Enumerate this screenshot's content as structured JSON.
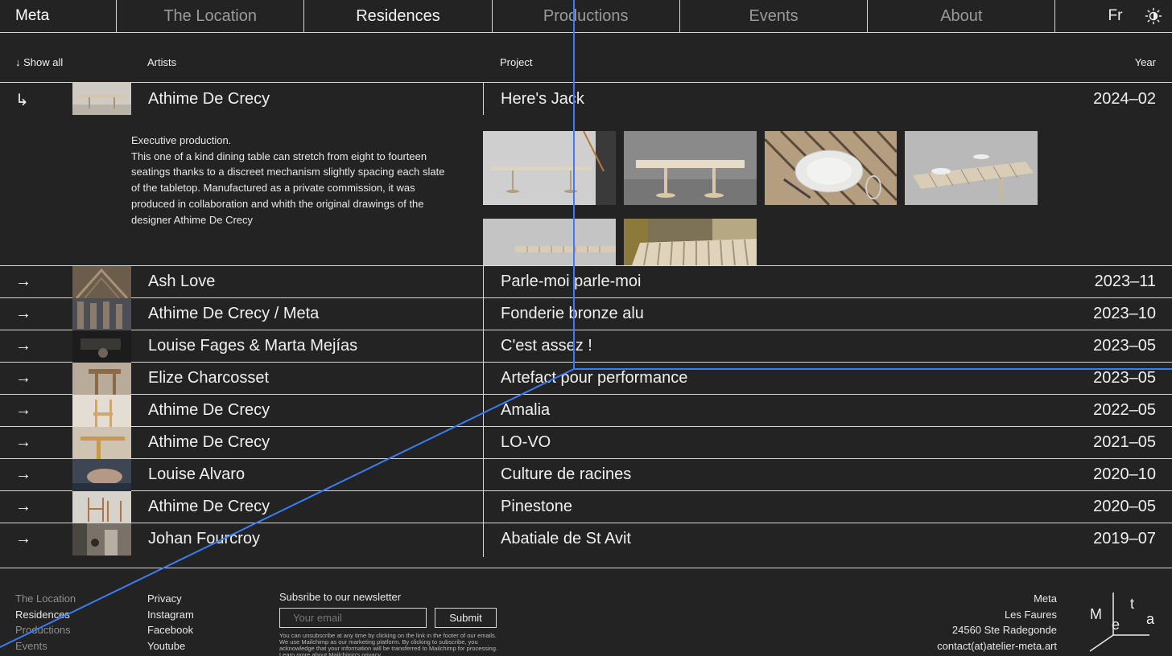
{
  "nav": {
    "brand": "Meta",
    "tabs": [
      "The Location",
      "Residences",
      "Productions",
      "Events",
      "About"
    ],
    "active_tab": "Residences",
    "language": "Fr",
    "theme_icon": "sun-icon"
  },
  "table_header": {
    "show_all": "↓ Show all",
    "artists": "Artists",
    "project": "Project",
    "year": "Year"
  },
  "expanded": {
    "arrow": "↳",
    "artist": "Athime De Crecy",
    "project": "Here's Jack",
    "year": "2024–02",
    "description": "Executive production.\nThis one of a kind dining table can stretch from eight to fourteen seatings thanks to a discreet mechanism slightly spacing each slate of the tabletop. Manufactured as a private commission, it was produced in collaboration and whith the original drawings of the designer Athime De Crecy"
  },
  "rows": [
    {
      "arrow": "→",
      "artist": "Ash Love",
      "project": "Parle-moi parle-moi",
      "year": "2023–11"
    },
    {
      "arrow": "→",
      "artist": "Athime De Crecy / Meta",
      "project": "Fonderie bronze alu",
      "year": "2023–10"
    },
    {
      "arrow": "→",
      "artist": "Louise Fages & Marta Mejías",
      "project": "C'est assez !",
      "year": "2023–05"
    },
    {
      "arrow": "→",
      "artist": "Elize Charcosset",
      "project": "Artefact pour performance",
      "year": "2023–05"
    },
    {
      "arrow": "→",
      "artist": "Athime De Crecy",
      "project": "Amalia",
      "year": "2022–05"
    },
    {
      "arrow": "→",
      "artist": "Athime De Crecy",
      "project": "LO-VO",
      "year": "2021–05"
    },
    {
      "arrow": "→",
      "artist": "Louise Alvaro",
      "project": "Culture de racines",
      "year": "2020–10"
    },
    {
      "arrow": "→",
      "artist": "Athime De Crecy",
      "project": "Pinestone",
      "year": "2020–05"
    },
    {
      "arrow": "→",
      "artist": "Johan Fourcroy",
      "project": "Abatiale de St Avit",
      "year": "2019–07"
    }
  ],
  "footer": {
    "site_links": [
      "The Location",
      "Residences",
      "Productions",
      "Events"
    ],
    "active_link": "Residences",
    "social_links": [
      "Privacy",
      "Instagram",
      "Facebook",
      "Youtube"
    ],
    "newsletter": {
      "title": "Subsribe to our newsletter",
      "placeholder": "Your email",
      "submit": "Submit",
      "legal": "You can unsubscribe at any time by clicking on the link in the footer of our emails. We use Mailchimp as our marketing platform. By clicking to subscribe, you acknowledge that your information will be transferred to Mailchimp for processing. Learn more about Mailchimp's privacy"
    },
    "address": [
      "Meta",
      "Les Faures",
      "24560 Ste Radegonde",
      "contact(at)atelier-meta.art"
    ],
    "logo_letters": [
      "M",
      "e",
      "t",
      "a"
    ]
  },
  "colors": {
    "background": "#232323",
    "text": "#f0f0f0",
    "muted": "#8f8f8f",
    "rule": "#d8d8d8",
    "accent_line": "#3a7cf2"
  }
}
